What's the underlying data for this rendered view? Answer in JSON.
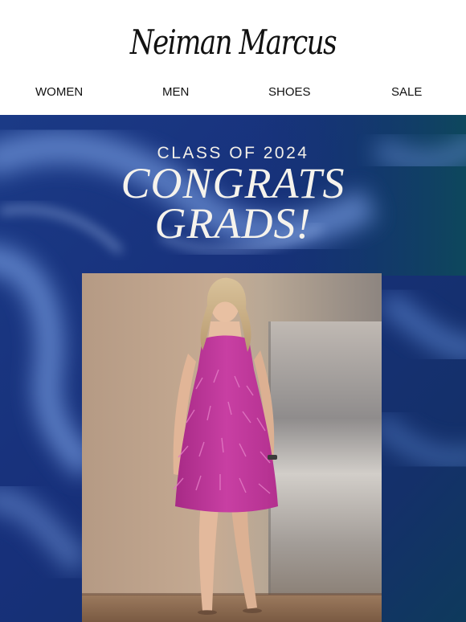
{
  "brand": {
    "logo_text": "Neiman Marcus"
  },
  "nav": {
    "items": [
      {
        "label": "WOMEN"
      },
      {
        "label": "MEN"
      },
      {
        "label": "SHOES"
      },
      {
        "label": "SALE"
      }
    ]
  },
  "hero": {
    "eyebrow": "CLASS OF 2024",
    "headline_line1": "CONGRATS",
    "headline_line2": "GRADS!",
    "background_color": "#1d3f8f",
    "dress_color": "#c2399e"
  }
}
